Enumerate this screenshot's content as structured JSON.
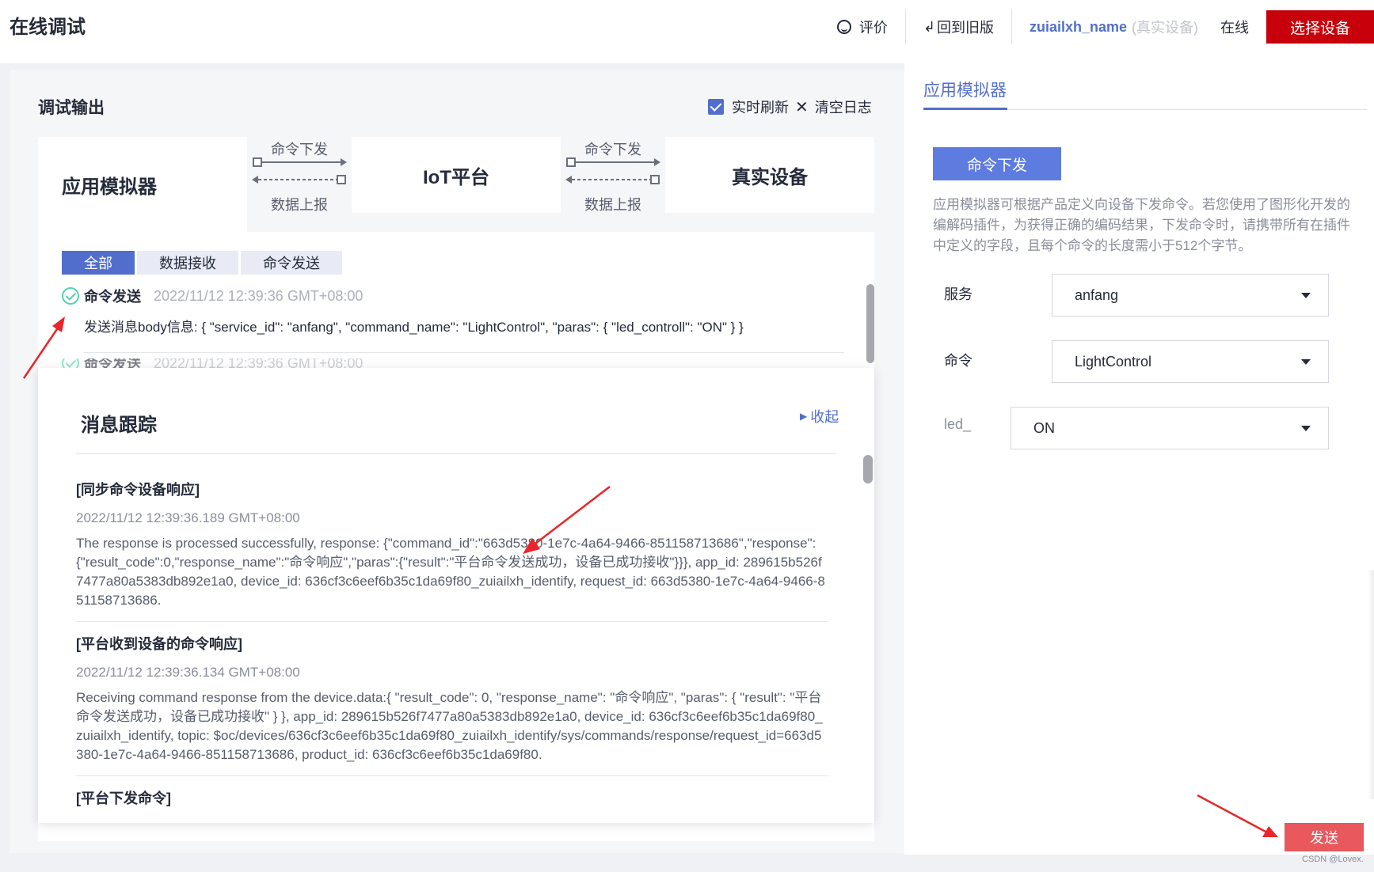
{
  "header": {
    "title": "在线调试",
    "rate_label": "评价",
    "back_label": "回到旧版",
    "device_name": "zuiailxh_name",
    "device_tag": "(真实设备)",
    "status": "在线",
    "select_device_label": "选择设备"
  },
  "debug": {
    "title": "调试输出",
    "realtime_label": "实时刷新",
    "clear_label": "清空日志",
    "flow": {
      "app": "应用模拟器",
      "iot": "IoT平台",
      "real": "真实设备",
      "down_label": "命令下发",
      "up_label": "数据上报"
    },
    "filters": [
      "全部",
      "数据接收",
      "命令发送"
    ],
    "log": {
      "type": "命令发送",
      "time": "2022/11/12 12:39:36 GMT+08:00",
      "body": "发送消息body信息: { \"service_id\": \"anfang\", \"command_name\": \"LightControl\", \"paras\": { \"led_controll\": \"ON\" } }"
    },
    "log_ghost": {
      "type": "命令发送",
      "time": "2022/11/12 12:39:36 GMT+08:00"
    }
  },
  "trace": {
    "title": "消息跟踪",
    "collapse_label": "收起",
    "items": [
      {
        "title": "[同步命令设备响应]",
        "time": "2022/11/12 12:39:36.189 GMT+08:00",
        "text": "The response is processed successfully, response: {\"command_id\":\"663d5380-1e7c-4a64-9466-851158713686\",\"response\":{\"result_code\":0,\"response_name\":\"命令响应\",\"paras\":{\"result\":\"平台命令发送成功，设备已成功接收\"}}}, app_id: 289615b526f7477a80a5383db892e1a0, device_id: 636cf3c6eef6b35c1da69f80_zuiailxh_identify, request_id: 663d5380-1e7c-4a64-9466-851158713686."
      },
      {
        "title": "[平台收到设备的命令响应]",
        "time": "2022/11/12 12:39:36.134 GMT+08:00",
        "text": "Receiving command response from the device.data:{ \"result_code\": 0, \"response_name\": \"命令响应\", \"paras\": { \"result\": \"平台命令发送成功，设备已成功接收\" } }, app_id: 289615b526f7477a80a5383db892e1a0, device_id: 636cf3c6eef6b35c1da69f80_zuiailxh_identify, topic: $oc/devices/636cf3c6eef6b35c1da69f80_zuiailxh_identify/sys/commands/response/request_id=663d5380-1e7c-4a64-9466-851158713686, product_id: 636cf3c6eef6b35c1da69f80."
      },
      {
        "title": "[平台下发命令]"
      }
    ]
  },
  "simulator": {
    "tab_label": "应用模拟器",
    "cmd_button_label": "命令下发",
    "description": "应用模拟器可根据产品定义向设备下发命令。若您使用了图形化开发的编解码插件，为获得正确的编码结果，下发命令时，请携带所有在插件中定义的字段，且每个命令的长度需小于512个字节。",
    "service_label": "服务",
    "service_value": "anfang",
    "command_label": "命令",
    "command_value": "LightControl",
    "led_label": "led_",
    "led_value": "ON",
    "send_label": "发送"
  },
  "watermark": "CSDN @Lovex.",
  "colors": {
    "accent": "#526ecc",
    "brand_red": "#c7000b",
    "success": "#50d4ab",
    "annotation_red": "#e8262b"
  }
}
